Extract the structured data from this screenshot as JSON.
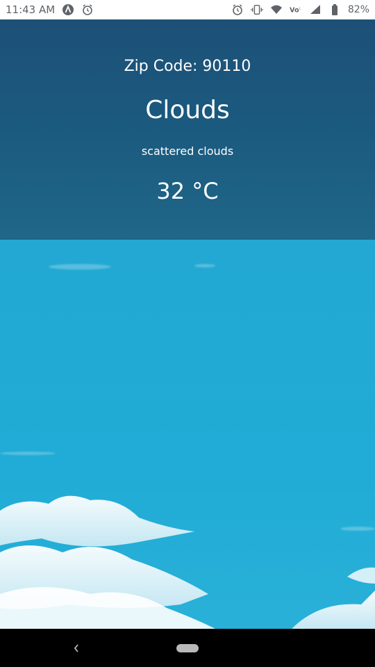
{
  "status_bar": {
    "time": "11:43 AM",
    "battery_percent": "82%"
  },
  "weather": {
    "zip_label": "Zip Code: 90110",
    "condition": "Clouds",
    "description": "scattered clouds",
    "temperature": "32 °C"
  },
  "colors": {
    "header_bg": "#1d5077",
    "sky": "#22a8d2",
    "nav_bg": "#000000"
  },
  "icons": {
    "status_left": [
      "app-a-icon",
      "alarm-icon"
    ],
    "status_right": [
      "alarm-icon",
      "vibrate-icon",
      "wifi-icon",
      "volte-icon",
      "signal-icon",
      "battery-icon"
    ],
    "nav": [
      "back-icon",
      "home-pill-icon"
    ]
  }
}
